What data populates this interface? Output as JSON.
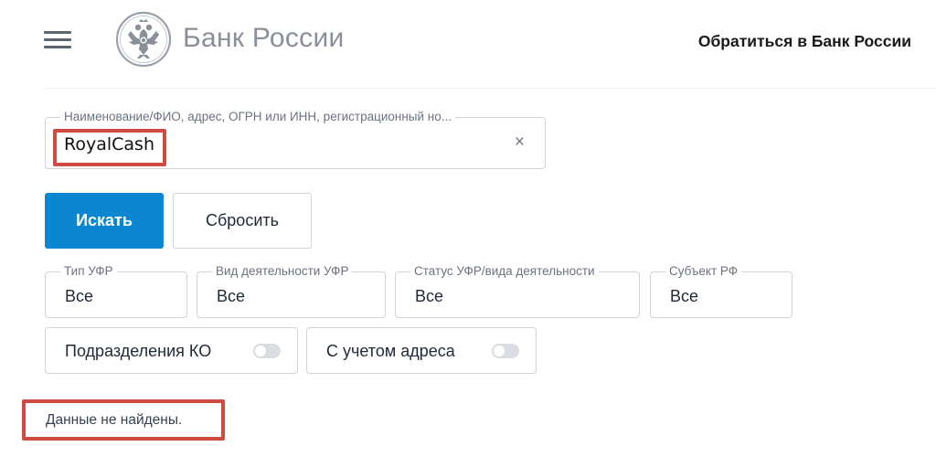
{
  "header": {
    "brand": "Банк России",
    "contact_link": "Обратиться в Банк России"
  },
  "search": {
    "label": "Наименование/ФИО, адрес, ОГРН или ИНН, регистрационный но...",
    "value": "RoyalCash",
    "clear_icon": "×"
  },
  "buttons": {
    "search": "Искать",
    "reset": "Сбросить"
  },
  "filters": [
    {
      "label": "Тип УФР",
      "value": "Все"
    },
    {
      "label": "Вид деятельности УФР",
      "value": "Все"
    },
    {
      "label": "Статус УФР/вида деятельности",
      "value": "Все"
    },
    {
      "label": "Субъект РФ",
      "value": "Все"
    }
  ],
  "toggles": [
    {
      "label": "Подразделения КО",
      "state": "off"
    },
    {
      "label": "С учетом адреса",
      "state": "off"
    }
  ],
  "result": {
    "message": "Данные не найдены."
  },
  "colors": {
    "primary_button": "#0a87d0",
    "highlight_box": "#cf4a40"
  },
  "icons": [
    "menu-icon",
    "bank-of-russia-eagle-logo",
    "clear-icon",
    "toggle-switch"
  ]
}
